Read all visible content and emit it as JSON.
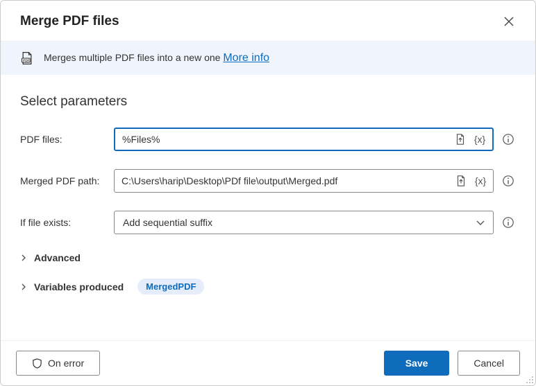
{
  "header": {
    "title": "Merge PDF files"
  },
  "banner": {
    "text": "Merges multiple PDF files into a new one ",
    "more_link": "More info"
  },
  "section_title": "Select parameters",
  "fields": {
    "pdf_files": {
      "label": "PDF files:",
      "value": "%Files%"
    },
    "merged_path": {
      "label": "Merged PDF path:",
      "value": "C:\\Users\\harip\\Desktop\\PDf file\\output\\Merged.pdf"
    },
    "if_exists": {
      "label": "If file exists:",
      "value": "Add sequential suffix"
    }
  },
  "expanders": {
    "advanced": "Advanced",
    "variables": "Variables produced",
    "variable_chip": "MergedPDF"
  },
  "footer": {
    "on_error": "On error",
    "save": "Save",
    "cancel": "Cancel"
  }
}
